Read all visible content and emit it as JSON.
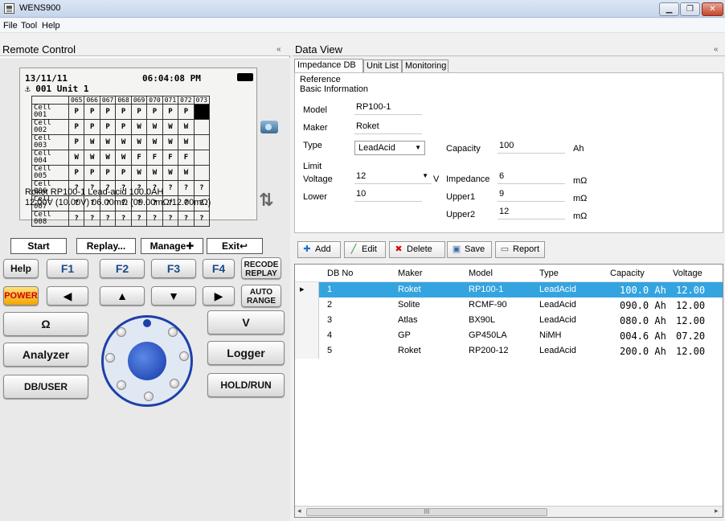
{
  "window": {
    "title": "WENS900",
    "min_icon": "minimize-icon",
    "max_icon": "maximize-icon",
    "close_icon": "close-icon"
  },
  "menu": [
    "File",
    "Tool",
    "Help"
  ],
  "left_panel": {
    "title": "Remote Control",
    "collapse": "«",
    "lcd": {
      "date": "13/11/11",
      "time": "06:04:08 PM",
      "unit": "⚓ 001 Unit 1",
      "columns": [
        "065",
        "066",
        "067",
        "068",
        "069",
        "070",
        "071",
        "072",
        "073"
      ],
      "rows": [
        {
          "label": "Cell 001",
          "values": [
            "P",
            "P",
            "P",
            "P",
            "P",
            "P",
            "P",
            "P",
            ""
          ]
        },
        {
          "label": "Cell 002",
          "values": [
            "P",
            "P",
            "P",
            "P",
            "W",
            "W",
            "W",
            "W",
            ""
          ]
        },
        {
          "label": "Cell 003",
          "values": [
            "P",
            "W",
            "W",
            "W",
            "W",
            "W",
            "W",
            "W",
            ""
          ]
        },
        {
          "label": "Cell 004",
          "values": [
            "W",
            "W",
            "W",
            "W",
            "F",
            "F",
            "F",
            "F",
            ""
          ]
        },
        {
          "label": "Cell 005",
          "values": [
            "P",
            "P",
            "P",
            "P",
            "W",
            "W",
            "W",
            "W",
            ""
          ]
        },
        {
          "label": "Cell 006",
          "values": [
            "?",
            "?",
            "?",
            "?",
            "?",
            "?",
            "?",
            "?",
            "?"
          ]
        },
        {
          "label": "Cell 007",
          "values": [
            "?",
            "?",
            "?",
            "?",
            "?",
            "?",
            "?",
            "?",
            "?"
          ]
        },
        {
          "label": "Cell 008",
          "values": [
            "?",
            "?",
            "?",
            "?",
            "?",
            "?",
            "?",
            "?",
            "?"
          ]
        }
      ],
      "info_line1": "Roket RP100-1 Lead-acid 100.0AH",
      "info_line2": "12.00V (10.00V)   06.00mΩ (09.00mΩ/12.00mΩ)"
    },
    "softkeys": [
      "Start",
      "Replay...",
      "Manage✚",
      "Exit↩"
    ],
    "buttons": {
      "help": "Help",
      "f1": "F1",
      "f2": "F2",
      "f3": "F3",
      "f4": "F4",
      "recode_replay_1": "RECODE",
      "recode_replay_2": "REPLAY",
      "power": "POWER",
      "left": "◀",
      "up": "▲",
      "down": "▼",
      "right": "▶",
      "auto_range_1": "AUTO",
      "auto_range_2": "RANGE",
      "ohm": "Ω",
      "volt": "V",
      "analyzer": "Analyzer",
      "logger": "Logger",
      "db_user": "DB/USER",
      "hold_run": "HOLD/RUN"
    }
  },
  "right_panel": {
    "title": "Data View",
    "collapse": "«",
    "tabs": [
      "Impedance DB",
      "Unit List",
      "Monitoring"
    ],
    "form": {
      "reference": "Reference",
      "basic_info": "Basic Information",
      "model_label": "Model",
      "model_value": "RP100-1",
      "maker_label": "Maker",
      "maker_value": "Roket",
      "type_label": "Type",
      "type_value": "LeadAcid",
      "capacity_label": "Capacity",
      "capacity_value": "100",
      "capacity_unit": "Ah",
      "limit": "Limit",
      "voltage_label": "Voltage",
      "voltage_value": "12",
      "voltage_unit": "V",
      "impedance_label": "Impedance",
      "impedance_value": "6",
      "impedance_unit": "mΩ",
      "lower_label": "Lower",
      "lower_value": "10",
      "upper1_label": "Upper1",
      "upper1_value": "9",
      "upper1_unit": "mΩ",
      "upper2_label": "Upper2",
      "upper2_value": "12",
      "upper2_unit": "mΩ"
    },
    "toolbar": [
      "Add",
      "Edit",
      "Delete",
      "Save",
      "Report"
    ],
    "grid": {
      "columns": [
        "DB No",
        "Maker",
        "Model",
        "Type",
        "Capacity",
        "Voltage"
      ],
      "rows": [
        [
          "1",
          "Roket",
          "RP100-1",
          "LeadAcid",
          "100.0 Ah",
          "12.00"
        ],
        [
          "2",
          "Solite",
          "RCMF-90",
          "LeadAcid",
          "090.0 Ah",
          "12.00"
        ],
        [
          "3",
          "Atlas",
          "BX90L",
          "LeadAcid",
          "080.0 Ah",
          "12.00"
        ],
        [
          "4",
          "GP",
          "GP450LA",
          "NiMH",
          "004.6 Ah",
          "07.20"
        ],
        [
          "5",
          "Roket",
          "RP200-12",
          "LeadAcid",
          "200.0 Ah",
          "12.00"
        ]
      ],
      "selected_row": 0,
      "scroll_thumb": "III"
    },
    "colors": {
      "selection": "#34a4e0",
      "dial": "#1e40a8"
    }
  }
}
